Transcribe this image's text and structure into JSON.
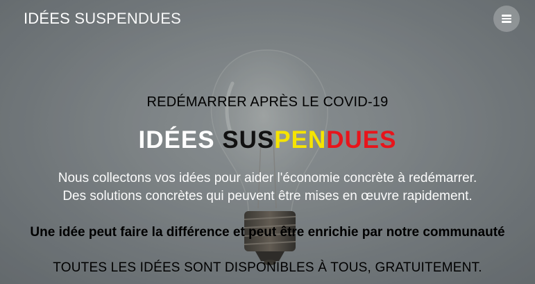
{
  "navbar": {
    "brand_bold": "IDÉES",
    "brand_light": "SUSPENDUES",
    "menu_icon": "hamburger-menu-icon"
  },
  "hero": {
    "kicker": "REDÉMARRER APRÈS LE COVID-19",
    "title": {
      "part1": "IDÉES",
      "part2": "SUS",
      "part3": "PEN",
      "part4": "DUES"
    },
    "lead_line1": "Nous collectons vos idées pour aider l'économie concrète à redémarrer.",
    "lead_line2": "Des solutions concrètes qui peuvent être mises en œuvre rapidement.",
    "bold_line": "Une idée peut faire la différence et peut être enrichie par notre communauté",
    "free_line": "TOUTES LES IDÉES SONT DISPONIBLES À TOUS, GRATUITEMENT.",
    "background_icon": "lightbulb-icon"
  },
  "colors": {
    "title_black": "#111111",
    "title_yellow": "#f6e400",
    "title_red": "#e8141b",
    "text": "#ffffff"
  }
}
